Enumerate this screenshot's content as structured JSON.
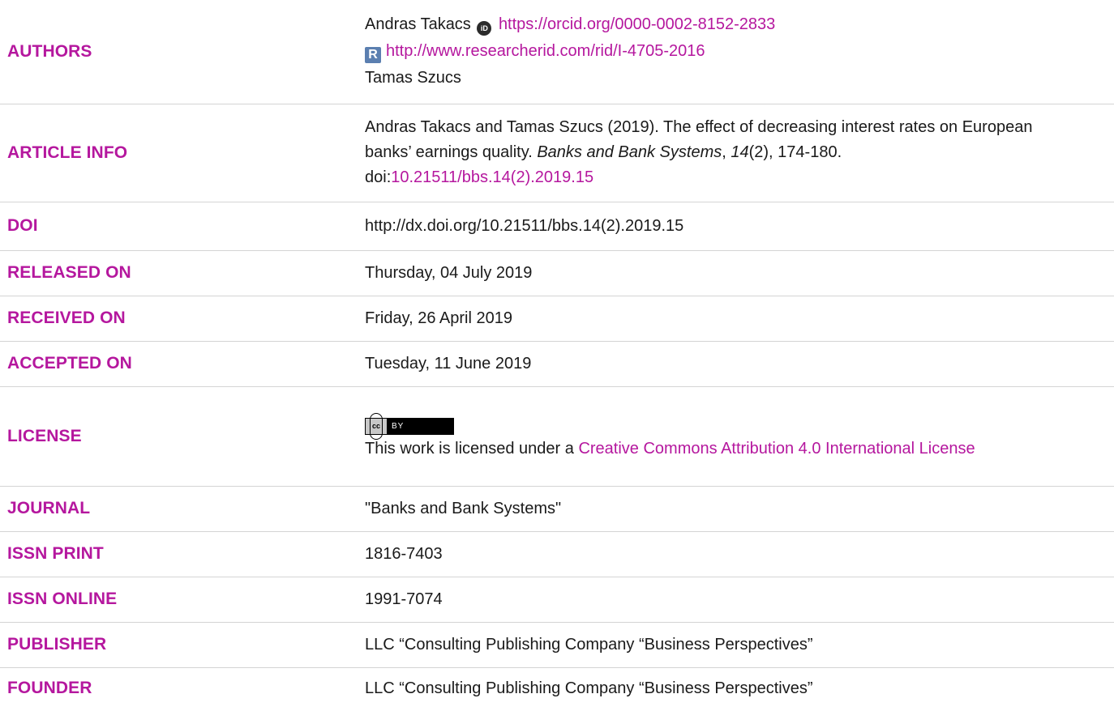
{
  "labels": {
    "authors": "AUTHORS",
    "article_info": "ARTICLE INFO",
    "doi": "DOI",
    "released_on": "RELEASED ON",
    "received_on": "RECEIVED ON",
    "accepted_on": "ACCEPTED ON",
    "license": "LICENSE",
    "journal": "JOURNAL",
    "issn_print": "ISSN PRINT",
    "issn_online": "ISSN ONLINE",
    "publisher": "PUBLISHER",
    "founder": "FOUNDER"
  },
  "authors": {
    "author1_name": "Andras Takacs",
    "orcid_icon_text": "iD",
    "orcid_url": "https://orcid.org/0000-0002-8152-2833",
    "researcherid_icon_text": "R",
    "researcherid_url": "http://www.researcherid.com/rid/I-4705-2016",
    "author2_name": "Tamas Szucs"
  },
  "article_info": {
    "citation_start": "Andras Takacs and Tamas Szucs (2019). The effect of decreasing interest rates on European banks’ earnings quality. ",
    "journal_italic": "Banks and Bank Systems",
    "comma": ", ",
    "volume_italic": "14",
    "citation_end": "(2), 174-180.",
    "doi_prefix": "doi:",
    "doi_link": "10.21511/bbs.14(2).2019.15"
  },
  "doi": "http://dx.doi.org/10.21511/bbs.14(2).2019.15",
  "released_on": "Thursday, 04 July 2019",
  "received_on": "Friday, 26 April 2019",
  "accepted_on": "Tuesday, 11 June 2019",
  "license": {
    "badge_cc": "cc",
    "badge_by": "BY",
    "text": "This work is licensed under a ",
    "link": "Creative Commons Attribution 4.0 International License"
  },
  "journal": "\"Banks and Bank Systems\"",
  "issn_print": "1816-7403",
  "issn_online": "1991-7074",
  "publisher": "LLC “Consulting Publishing Company “Business Perspectives”",
  "founder": "LLC “Consulting Publishing Company “Business Perspectives”",
  "colors": {
    "label": "#b5179e",
    "link": "#b5179e",
    "text": "#1a1a1a",
    "divider": "#d4d4d4"
  }
}
